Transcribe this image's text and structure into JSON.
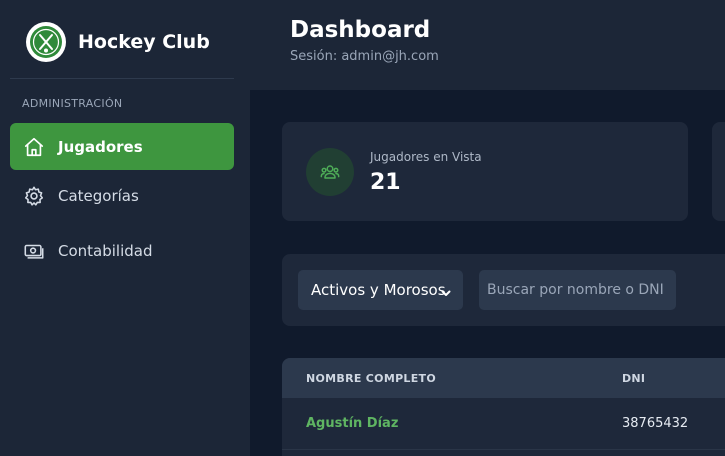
{
  "app": {
    "brand_name": "Hockey Club",
    "logo_icon": "club-crest-icon"
  },
  "header": {
    "title": "Dashboard",
    "session": "Sesión: admin@jh.com"
  },
  "sidebar": {
    "section_label": "ADMINISTRACIÓN",
    "items": [
      {
        "label": "Jugadores",
        "icon": "home-icon",
        "active": true
      },
      {
        "label": "Categorías",
        "icon": "gear-icon",
        "active": false
      },
      {
        "label": "Contabilidad",
        "icon": "cash-icon",
        "active": false
      }
    ]
  },
  "stats": {
    "players_label": "Jugadores en Vista",
    "players_value": "21",
    "icon": "users-icon"
  },
  "filters": {
    "status_selected": "Activos y Morosos",
    "search_placeholder": "Buscar por nombre o DNI"
  },
  "table": {
    "columns": [
      "NOMBRE COMPLETO",
      "DNI"
    ],
    "rows": [
      {
        "name": "Agustín Díaz",
        "dni": "38765432"
      }
    ]
  },
  "colors": {
    "accent_green": "#3e963f",
    "sidebar_bg": "#1c2637",
    "page_bg": "#101a2c"
  }
}
